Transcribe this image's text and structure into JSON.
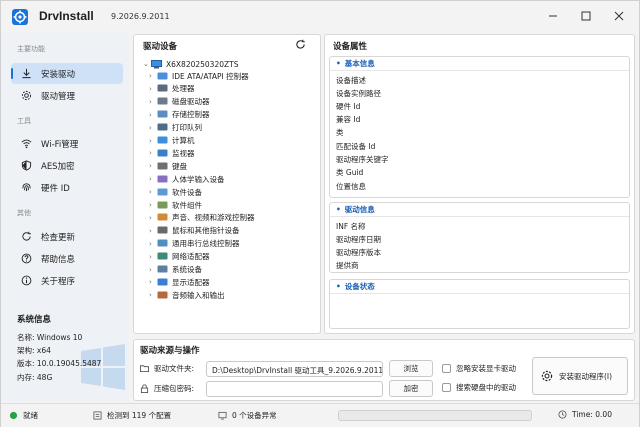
{
  "app": {
    "title": "DrvInstall",
    "version": "9.2026.9.2011"
  },
  "sidebar": {
    "sections": [
      "主要功能",
      "工具",
      "其他"
    ],
    "items": [
      {
        "label": "安装驱动",
        "icon": "download-icon",
        "active": true
      },
      {
        "label": "驱动管理",
        "icon": "gear-icon"
      },
      {
        "label": "Wi-Fi管理",
        "icon": "wifi-icon"
      },
      {
        "label": "AES加密",
        "icon": "shield-icon"
      },
      {
        "label": "硬件 ID",
        "icon": "fingerprint-icon"
      },
      {
        "label": "检查更新",
        "icon": "refresh-icon"
      },
      {
        "label": "帮助信息",
        "icon": "help-icon"
      },
      {
        "label": "关于程序",
        "icon": "info-icon"
      }
    ],
    "system_info": {
      "title": "系统信息",
      "rows": [
        "名称: Windows 10",
        "架构: x64",
        "版本: 10.0.19045.5487",
        "内存: 48G"
      ]
    }
  },
  "device_tree": {
    "title": "驱动设备",
    "root": "X6X820250320ZTS",
    "items": [
      {
        "label": "IDE ATA/ATAPI 控制器",
        "icon": "ide-controller-icon"
      },
      {
        "label": "处理器",
        "icon": "processor-icon"
      },
      {
        "label": "磁盘驱动器",
        "icon": "disk-drive-icon"
      },
      {
        "label": "存储控制器",
        "icon": "storage-controller-icon"
      },
      {
        "label": "打印队列",
        "icon": "printer-icon"
      },
      {
        "label": "计算机",
        "icon": "computer-icon"
      },
      {
        "label": "监视器",
        "icon": "monitor-icon"
      },
      {
        "label": "键盘",
        "icon": "keyboard-icon"
      },
      {
        "label": "人体学输入设备",
        "icon": "hid-icon"
      },
      {
        "label": "软件设备",
        "icon": "software-device-icon"
      },
      {
        "label": "软件组件",
        "icon": "software-component-icon"
      },
      {
        "label": "声音、视频和游戏控制器",
        "icon": "audio-icon"
      },
      {
        "label": "鼠标和其他指针设备",
        "icon": "mouse-icon"
      },
      {
        "label": "通用串行总线控制器",
        "icon": "usb-icon"
      },
      {
        "label": "网络适配器",
        "icon": "network-adapter-icon"
      },
      {
        "label": "系统设备",
        "icon": "system-device-icon"
      },
      {
        "label": "显示适配器",
        "icon": "display-adapter-icon"
      },
      {
        "label": "音频输入和输出",
        "icon": "audio-io-icon"
      }
    ]
  },
  "properties": {
    "title": "设备属性",
    "basic": {
      "heading": "基本信息",
      "rows": [
        "设备描述",
        "设备实例路径",
        "硬件 Id",
        "兼容 Id",
        "类",
        "匹配设备 Id",
        "驱动程序关键字",
        "类 Guid",
        "位置信息"
      ]
    },
    "driver": {
      "heading": "驱动信息",
      "rows": [
        "INF 名称",
        "驱动程序日期",
        "驱动程序版本",
        "提供商"
      ]
    },
    "status": {
      "heading": "设备状态"
    }
  },
  "source": {
    "title": "驱动来源与操作",
    "folder_label": "驱动文件夹:",
    "folder_value": "D:\\Desktop\\DrvInstall 驱动工具_9.2026.9.2011...",
    "browse_label": "浏览",
    "password_label": "压缩包密码:",
    "password_value": "",
    "encrypt_label": "加密",
    "option_ignore_gpu": "忽略安装显卡驱动",
    "option_search_disk": "搜索硬盘中的驱动",
    "install_label": "安装驱动程序(I)"
  },
  "statusbar": {
    "state": "就绪",
    "detected": "检测到 119 个配置",
    "abnormal": "0 个设备异常",
    "time": "Time: 0.00",
    "progress": 0
  },
  "colors": {
    "accent": "#1a73d9",
    "active_bg": "#cfe1f7",
    "status_ok": "#2ea043"
  }
}
